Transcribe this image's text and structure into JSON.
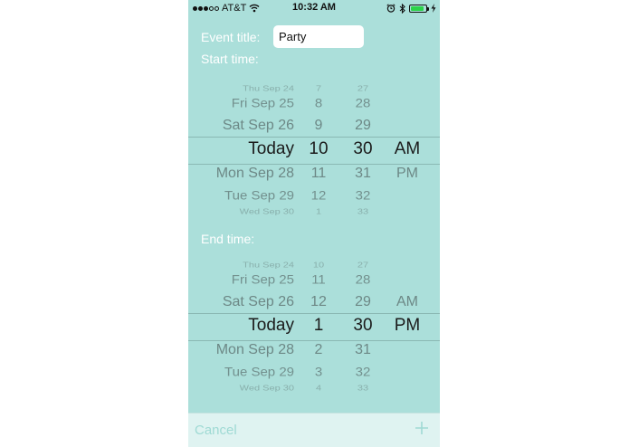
{
  "status_bar": {
    "carrier": "AT&T",
    "time": "10:32 AM"
  },
  "form": {
    "event_title_label": "Event title:",
    "event_title_value": "Party",
    "start_time_label": "Start time:",
    "end_time_label": "End time:"
  },
  "start_picker": {
    "rows": [
      {
        "date": "Thu Sep 24",
        "hour": "7",
        "minute": "27",
        "ampm": ""
      },
      {
        "date": "Fri Sep 25",
        "hour": "8",
        "minute": "28",
        "ampm": ""
      },
      {
        "date": "Sat Sep 26",
        "hour": "9",
        "minute": "29",
        "ampm": ""
      },
      {
        "date": "Today",
        "hour": "10",
        "minute": "30",
        "ampm": "AM"
      },
      {
        "date": "Mon Sep 28",
        "hour": "11",
        "minute": "31",
        "ampm": "PM"
      },
      {
        "date": "Tue Sep 29",
        "hour": "12",
        "minute": "32",
        "ampm": ""
      },
      {
        "date": "Wed Sep 30",
        "hour": "1",
        "minute": "33",
        "ampm": ""
      }
    ]
  },
  "end_picker": {
    "rows": [
      {
        "date": "Thu Sep 24",
        "hour": "10",
        "minute": "27",
        "ampm": ""
      },
      {
        "date": "Fri Sep 25",
        "hour": "11",
        "minute": "28",
        "ampm": ""
      },
      {
        "date": "Sat Sep 26",
        "hour": "12",
        "minute": "29",
        "ampm": "AM"
      },
      {
        "date": "Today",
        "hour": "1",
        "minute": "30",
        "ampm": "PM"
      },
      {
        "date": "Mon Sep 28",
        "hour": "2",
        "minute": "31",
        "ampm": ""
      },
      {
        "date": "Tue Sep 29",
        "hour": "3",
        "minute": "32",
        "ampm": ""
      },
      {
        "date": "Wed Sep 30",
        "hour": "4",
        "minute": "33",
        "ampm": ""
      }
    ]
  },
  "toolbar": {
    "cancel_label": "Cancel"
  },
  "colors": {
    "background": "#abdfda",
    "label": "#ffffff",
    "selected_text": "#1b1b1b",
    "unselected_text": "#6d8886",
    "toolbar_tint": "#9fdad4",
    "battery": "#2bd34a"
  },
  "icons": [
    "signal-dots-icon",
    "wifi-icon",
    "alarm-icon",
    "bluetooth-icon",
    "battery-icon",
    "charging-bolt-icon",
    "plus-icon"
  ],
  "battery_level": 0.9
}
